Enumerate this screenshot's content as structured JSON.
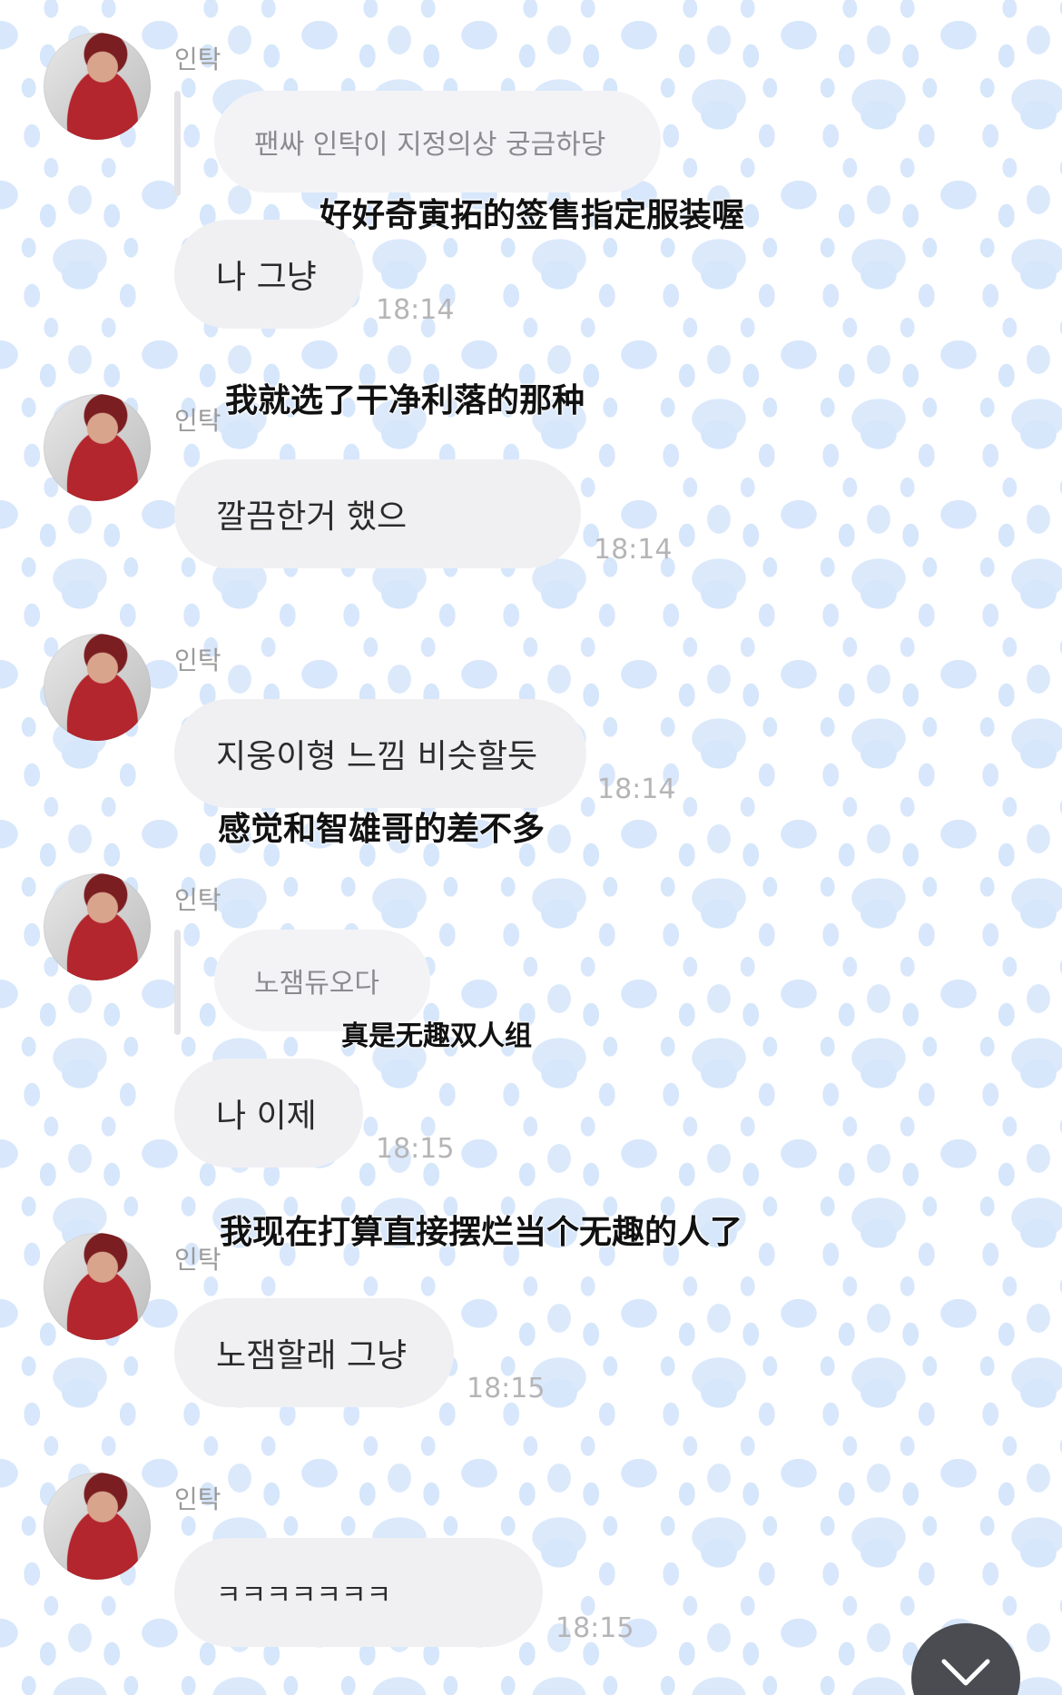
{
  "colors": {
    "bubble": "#f0f0f3",
    "timestamp": "#b5b5b8",
    "sender": "#9a9a9a",
    "paw": "#d6e6fb",
    "scroll_button": "#4a4c52"
  },
  "messages": [
    {
      "sender": "인탁",
      "quote": "팬싸 인탁이 지정의상 궁금하당",
      "caption": "好好奇寅拓的签售指定服装喔",
      "text": "나 그냥",
      "time": "18:14"
    },
    {
      "sender": "인탁",
      "caption": "我就选了干净利落的那种",
      "text": "깔끔한거 했으",
      "time": "18:14"
    },
    {
      "sender": "인탁",
      "text": "지웅이형 느낌 비슷할듯",
      "caption": "感觉和智雄哥的差不多",
      "time": "18:14"
    },
    {
      "sender": "인탁",
      "quote": "노잼듀오다",
      "caption": "真是无趣双人组",
      "text": "나 이제",
      "time": "18:15"
    },
    {
      "sender": "인탁",
      "caption": "我现在打算直接摆烂当个无趣的人了",
      "text": "노잼할래 그냥",
      "time": "18:15"
    },
    {
      "sender": "인탁",
      "text": "ㅋㅋㅋㅋㅋㅋㅋ",
      "time": "18:15"
    }
  ],
  "scroll_button_icon": "chevron-down-icon"
}
